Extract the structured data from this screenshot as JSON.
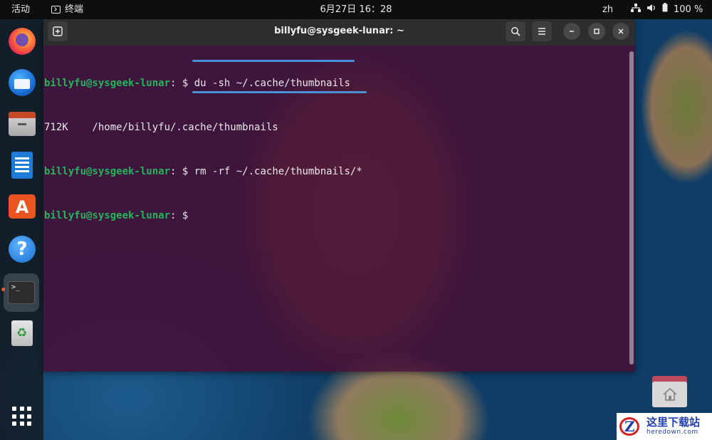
{
  "topbar": {
    "activities": "活动",
    "app_name": "终端",
    "clock": "6月27日  16：28",
    "lang": "zh",
    "battery": "100 %",
    "icons": [
      "network-icon",
      "volume-icon",
      "battery-icon"
    ]
  },
  "dock": {
    "items": [
      {
        "name": "firefox",
        "icon": "firefox-icon"
      },
      {
        "name": "thunderbird",
        "icon": "thunderbird-icon"
      },
      {
        "name": "files",
        "icon": "files-icon"
      },
      {
        "name": "libreoffice-writer",
        "icon": "writer-icon"
      },
      {
        "name": "software",
        "icon": "app-store-icon",
        "glyph": "A"
      },
      {
        "name": "help",
        "icon": "help-icon",
        "glyph": "?"
      },
      {
        "name": "terminal",
        "icon": "terminal-icon",
        "glyph": ">_",
        "active": true
      },
      {
        "name": "trash",
        "icon": "trash-icon"
      }
    ],
    "show_apps_icon": "app-grid-icon"
  },
  "terminal": {
    "title": "billyfu@sysgeek-lunar: ~",
    "lines": [
      {
        "user": "billyfu@sysgeek-lunar",
        "sep": ":",
        "cwd": " ",
        "prompt": "$ ",
        "cmd": "du -sh ~/.cache/thumbnails"
      },
      {
        "output": "712K    /home/billyfu/.cache/thumbnails"
      },
      {
        "user": "billyfu@sysgeek-lunar",
        "sep": ":",
        "cwd": " ",
        "prompt": "$ ",
        "cmd": "rm -rf ~/.cache/thumbnails/*"
      },
      {
        "user": "billyfu@sysgeek-lunar",
        "sep": ":",
        "cwd": " ",
        "prompt": "$ ",
        "cmd": ""
      }
    ],
    "accent_color": "#4a90d9",
    "user_color": "#26b35a"
  },
  "desktop": {
    "home_icon": "home-folder-icon"
  },
  "watermark": {
    "cn": "这里下载站",
    "en": "heredown.com"
  }
}
